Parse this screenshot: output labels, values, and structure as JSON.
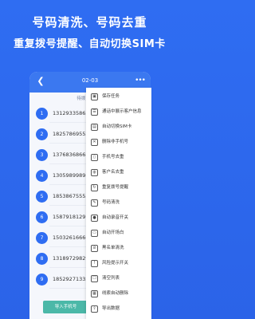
{
  "promo": {
    "line1": "号码清洗、号码去重",
    "line2": "重复拨号提醒、自动切换SIM卡"
  },
  "header": {
    "title": "02-03",
    "back_icon": "chevron-left-icon",
    "more_icon": "more-dots-icon"
  },
  "list": {
    "caption": "待拨电话(26)",
    "contacts": [
      {
        "index": "1",
        "phone": "13129335865"
      },
      {
        "index": "2",
        "phone": "18257869552"
      },
      {
        "index": "3",
        "phone": "13768368668"
      },
      {
        "index": "4",
        "phone": "13059899898"
      },
      {
        "index": "5",
        "phone": "18538675555"
      },
      {
        "index": "6",
        "phone": "15879181297"
      },
      {
        "index": "7",
        "phone": "15032616666"
      },
      {
        "index": "8",
        "phone": "13189729829"
      },
      {
        "index": "9",
        "phone": "18529271333"
      }
    ]
  },
  "import_button": {
    "label": "导入手机号"
  },
  "menu": {
    "items": [
      {
        "label": "保存任务",
        "icon": "save-icon"
      },
      {
        "label": "通话中展示客户信息",
        "icon": "contact-card-icon"
      },
      {
        "label": "自动切换SIM卡",
        "icon": "sim-card-icon"
      },
      {
        "label": "删除非手机号",
        "icon": "delete-icon"
      },
      {
        "label": "手机号去重",
        "icon": "dedupe-icon"
      },
      {
        "label": "客户名去重",
        "icon": "user-dedupe-icon"
      },
      {
        "label": "重复拨号提醒",
        "icon": "repeat-call-icon"
      },
      {
        "label": "号码清洗",
        "icon": "clean-icon"
      },
      {
        "label": "自动录音开关",
        "icon": "record-icon"
      },
      {
        "label": "自动开场白",
        "icon": "greeting-icon"
      },
      {
        "label": "黑名单清洗",
        "icon": "blacklist-icon"
      },
      {
        "label": "风险提示开关",
        "icon": "warning-icon"
      },
      {
        "label": "清空列表",
        "icon": "clear-list-icon"
      },
      {
        "label": "线索自动删除",
        "icon": "auto-delete-icon"
      },
      {
        "label": "导出数据",
        "icon": "export-icon"
      }
    ]
  }
}
